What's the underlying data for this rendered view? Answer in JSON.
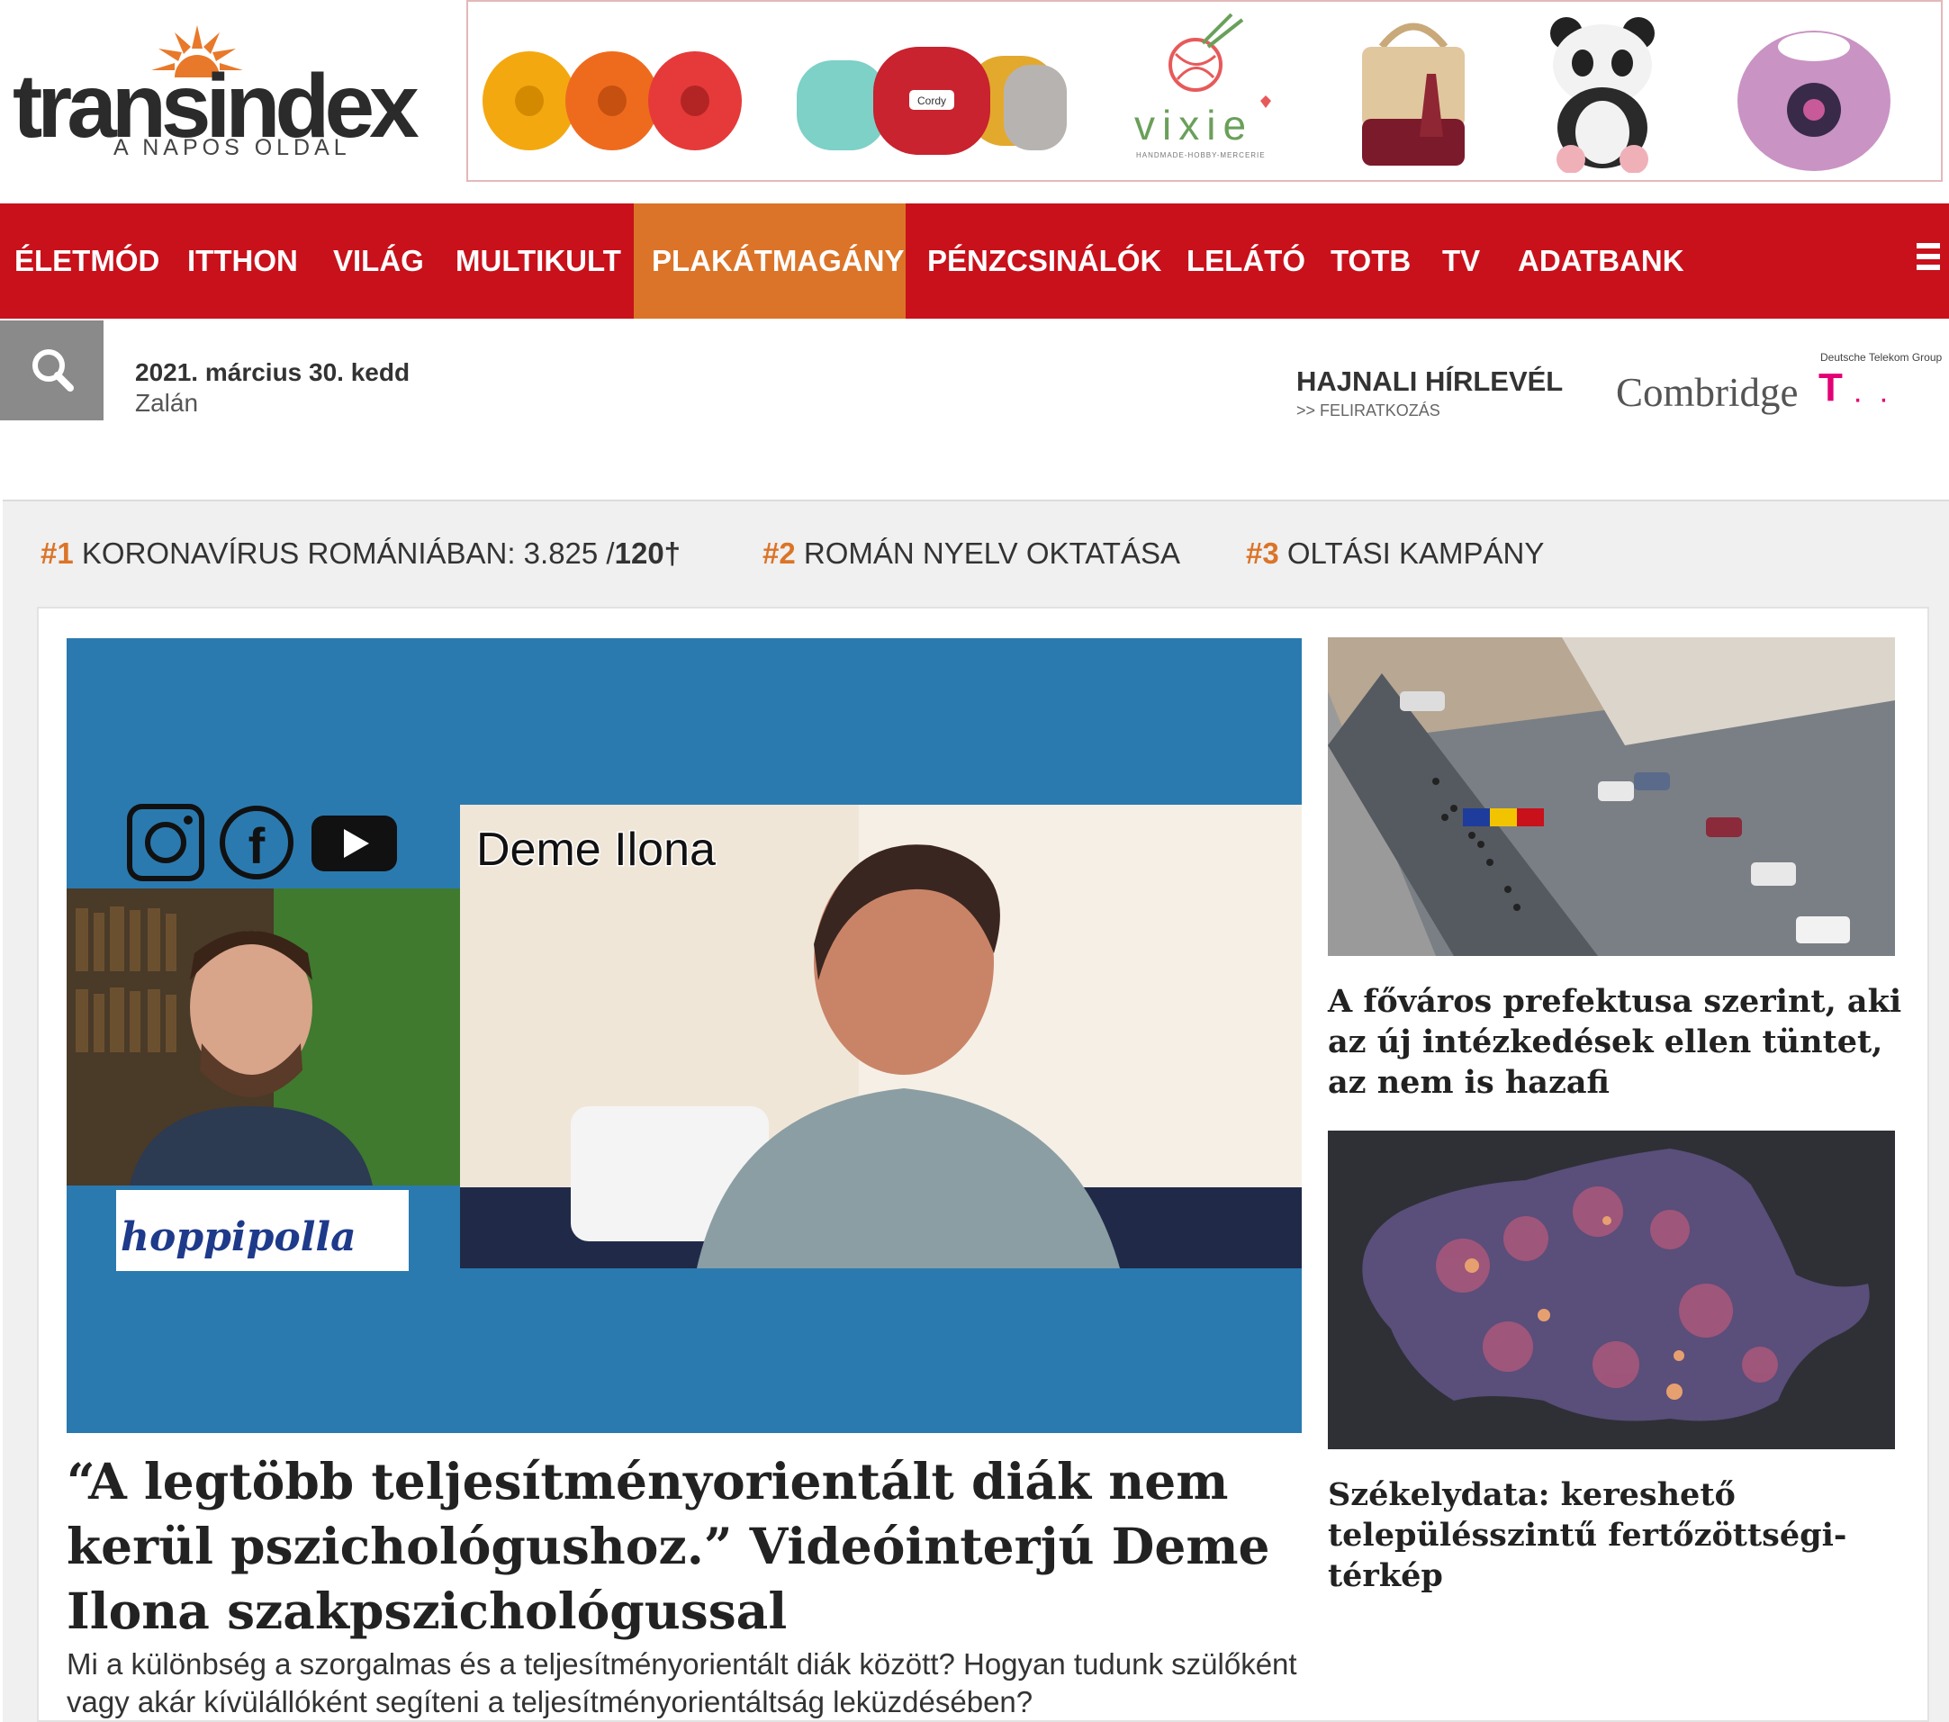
{
  "brand": {
    "name": "transindex",
    "tagline": "A NAPOS OLDAL"
  },
  "ad_banner": {
    "brand_text": "vixie",
    "brand_sub": "HANDMADE-HOBBY-MERCERIE",
    "label_text": "Cordy"
  },
  "nav": {
    "items": [
      {
        "label": "ÉLETMÓD"
      },
      {
        "label": "ITTHON"
      },
      {
        "label": "VILÁG"
      },
      {
        "label": "MULTIKULT"
      },
      {
        "label": "PLAKÁTMAGÁNY",
        "active": true
      },
      {
        "label": "PÉNZCSINÁLÓK"
      },
      {
        "label": "LELÁTÓ"
      },
      {
        "label": "TOTB"
      },
      {
        "label": "TV"
      },
      {
        "label": "ADATBANK"
      }
    ],
    "active_color": "#db7428",
    "bar_color": "#c8111b"
  },
  "subbar": {
    "date": "2021. március 30. kedd",
    "nameday": "Zalán",
    "newsletter_title": "HAJNALI HÍRLEVÉL",
    "newsletter_sub": ">> FELIRATKOZÁS",
    "sponsor1": "Combridge",
    "sponsor2_group": "Deutsche Telekom Group",
    "sponsor2_mark": "T",
    "sponsor2_dots": "· ·"
  },
  "trending": [
    {
      "num": "#1",
      "text": "KORONAVÍRUS ROMÁNIÁBAN: 3.825 /",
      "extra": "120†"
    },
    {
      "num": "#2",
      "text": "ROMÁN NYELV OKTATÁSA",
      "extra": ""
    },
    {
      "num": "#3",
      "text": "OLTÁSI KAMPÁNY",
      "extra": ""
    }
  ],
  "hero": {
    "video_name_label": "Deme Ilona",
    "video_logo_text": "hoppipolla",
    "title": "“A legtöbb teljesítményorientált diák nem kerül pszichológushoz.” Videóinterjú Deme Ilona szakpszichológussal",
    "lead": "Mi a különbség a szorgalmas és a teljesítményorientált diák között? Hogyan tudunk szülőként vagy akár kívülállóként segíteni a teljesítményorientáltság leküzdésében?"
  },
  "side_articles": [
    {
      "title": "A főváros prefektusa szerint, aki az új intézkedések ellen tüntet, az nem is hazafi"
    },
    {
      "title": "Székelydata: kereshető településszintű fertőzöttségi-térkép"
    }
  ]
}
